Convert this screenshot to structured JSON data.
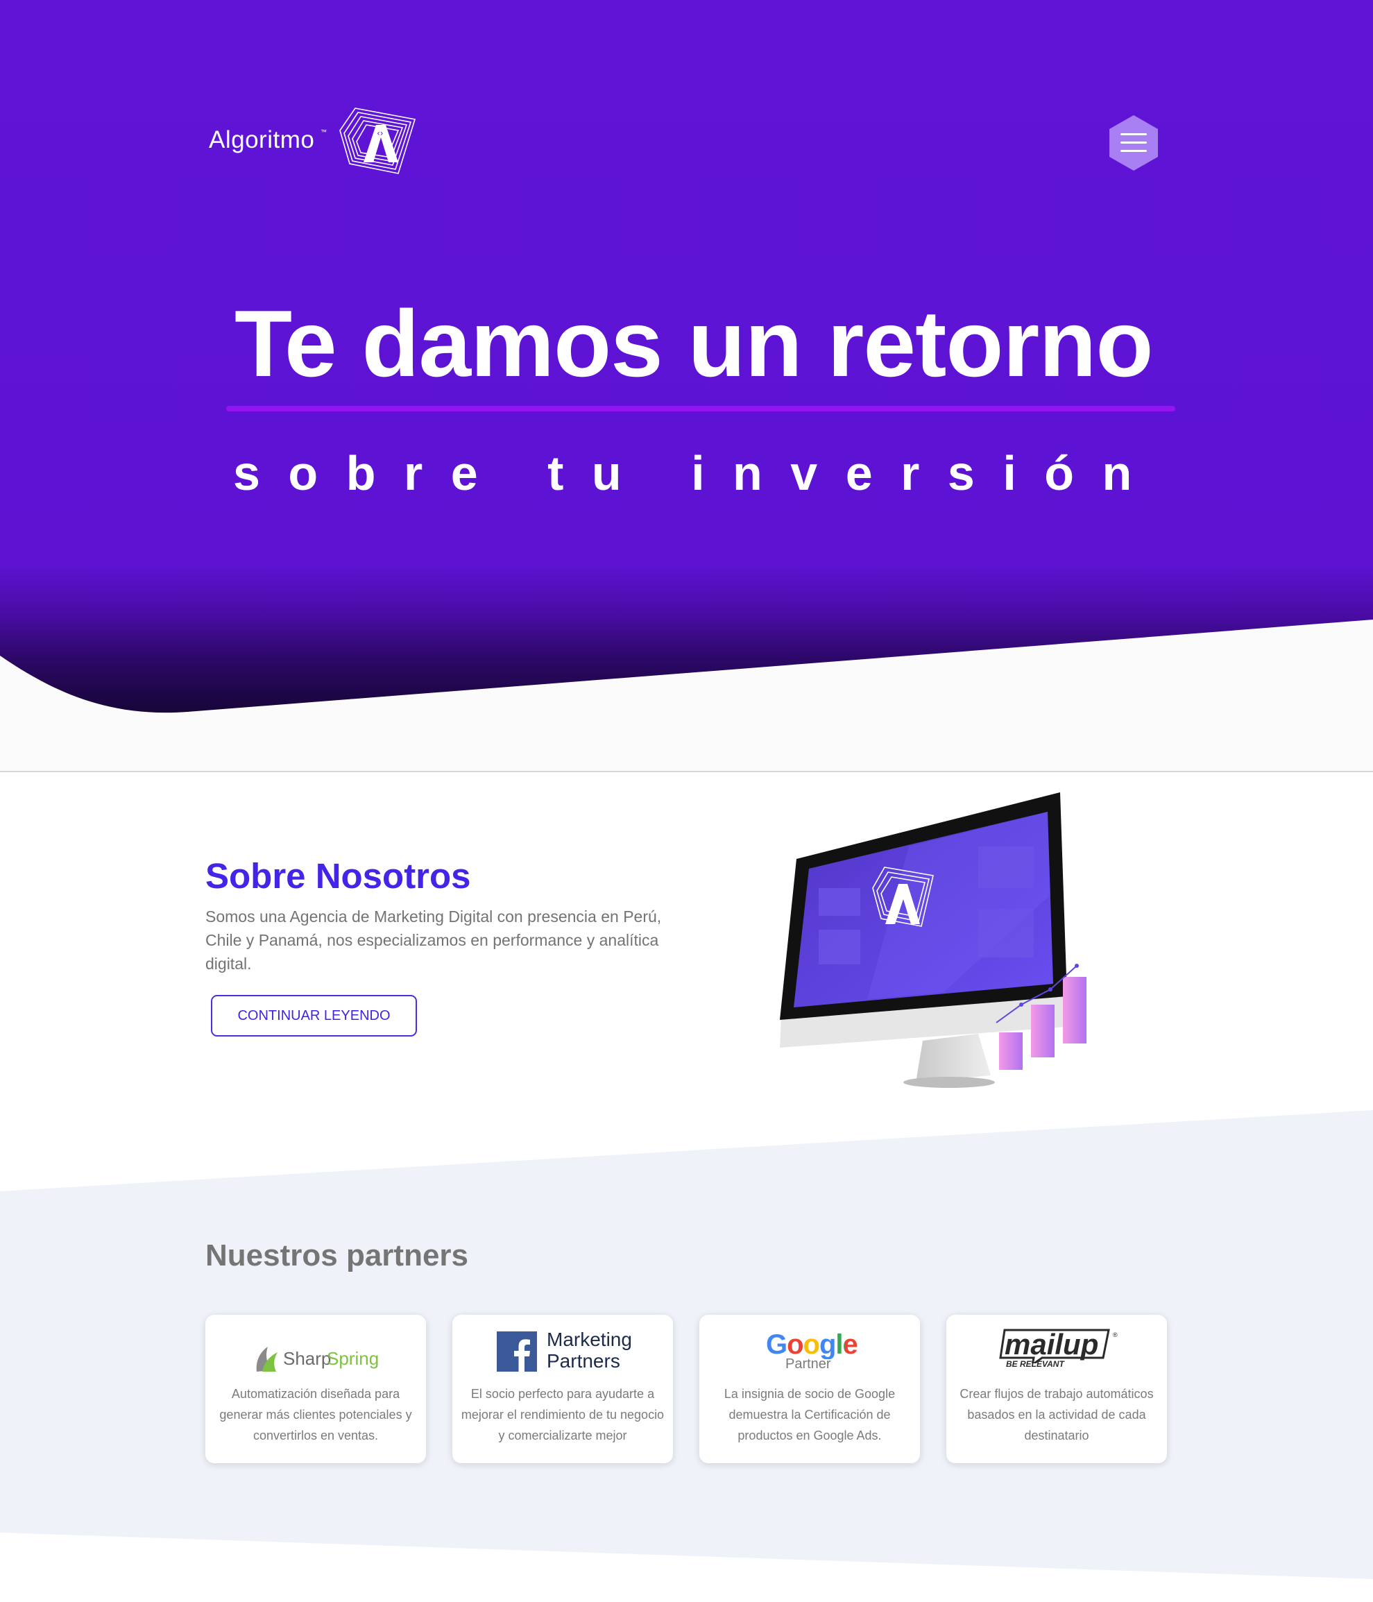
{
  "brand": {
    "name": "Algoritmo",
    "tm": "™",
    "colors": {
      "hero": "#5f14d6",
      "accent": "#4424e6",
      "underline": "#9612f0",
      "menu": "#a980f4"
    }
  },
  "nav": {
    "menu_icon": "hamburger-menu-icon"
  },
  "hero": {
    "title": "Te damos un retorno",
    "subtitle": "sobre tu inversión"
  },
  "about": {
    "title": "Sobre Nosotros",
    "text": "Somos una Agencia de Marketing Digital con presencia en Perú, Chile y Panamá, nos especializamos en performance y analítica digital.",
    "button_label": "CONTINUAR LEYENDO"
  },
  "partners": {
    "title": "Nuestros partners",
    "items": [
      {
        "logo_word_1": "Sharp",
        "logo_word_2": "Spring",
        "description": "Automatización diseñada para generar más clientes potenciales y convertirlos en ventas."
      },
      {
        "logo_line_1": "Marketing",
        "logo_line_2": "Partners",
        "description": "El socio perfecto para ayudarte a mejorar el rendimiento de tu negocio y comercializarte mejor"
      },
      {
        "logo_word": "Google",
        "logo_sub": "Partner",
        "description": "La insignia de socio de Google demuestra la Certificación de productos en Google Ads."
      },
      {
        "logo_word": "mailup",
        "logo_tagline": "BE RELEVANT",
        "logo_reg": "®",
        "description": "Crear flujos de trabajo automáticos basados en la actividad de cada destinatario"
      }
    ]
  }
}
